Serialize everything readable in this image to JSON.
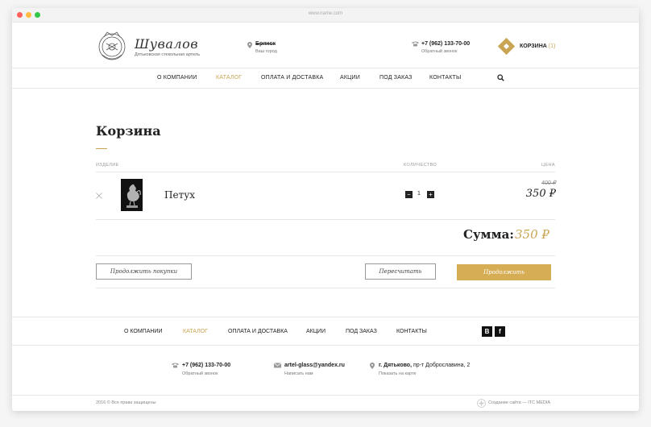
{
  "browser": {
    "url": "www.name.com"
  },
  "brand": {
    "name": "Шувалов",
    "tagline": "Дятьковская стекольная артель"
  },
  "city": {
    "name": "Брянск",
    "caption": "Ваш город"
  },
  "phone": {
    "number": "+7 (962) 133-70-00",
    "caption": "Обратный звонок"
  },
  "cart": {
    "label": "КОРЗИНА",
    "count": "(1)"
  },
  "nav": {
    "items": [
      {
        "label": "О КОМПАНИИ",
        "active": false
      },
      {
        "label": "КАТАЛОГ",
        "active": true
      },
      {
        "label": "ОПЛАТА И ДОСТАВКА",
        "active": false
      },
      {
        "label": "АКЦИИ",
        "active": false
      },
      {
        "label": "ПОД ЗАКАЗ",
        "active": false
      },
      {
        "label": "КОНТАКТЫ",
        "active": false
      }
    ],
    "search_icon": "search-icon"
  },
  "page": {
    "title": "Корзина",
    "columns": {
      "item": "ИЗДЕЛИЕ",
      "quantity": "КОЛИЧЕСТВО",
      "price": "ЦЕНА"
    },
    "items": [
      {
        "name": "Петух",
        "quantity": "1",
        "old_price": "400 ₽",
        "price": "350 ₽"
      }
    ],
    "total_label": "Сумма:",
    "total_value": "350 ₽",
    "buttons": {
      "continue_shopping": "Продолжить покупки",
      "recalculate": "Пересчитать",
      "proceed": "Продолжить"
    }
  },
  "footer": {
    "nav": [
      {
        "label": "О КОМПАНИИ",
        "active": false
      },
      {
        "label": "КАТАЛОГ",
        "active": true
      },
      {
        "label": "ОПЛАТА И ДОСТАВКА",
        "active": false
      },
      {
        "label": "АКЦИИ",
        "active": false
      },
      {
        "label": "ПОД ЗАКАЗ",
        "active": false
      },
      {
        "label": "КОНТАКТЫ",
        "active": false
      }
    ],
    "social": {
      "vk": "В",
      "facebook": "f"
    },
    "contacts": {
      "phone": {
        "main": "+7 (962) 133-70-00",
        "sub": "Обратный звонок"
      },
      "email": {
        "main": "artel-glass@yandex.ru",
        "sub": "Написать нам"
      },
      "address": {
        "city": "г. Дятьково,",
        "street": " пр-т Доброславина, 2",
        "sub": "Показать на карте"
      }
    },
    "copyright": "2016 © Все права защищены",
    "credit": "Создание сайта — ITC MEDIA"
  },
  "colors": {
    "accent": "#c9a553",
    "button_gold": "#d6ad54",
    "text": "#222222"
  }
}
